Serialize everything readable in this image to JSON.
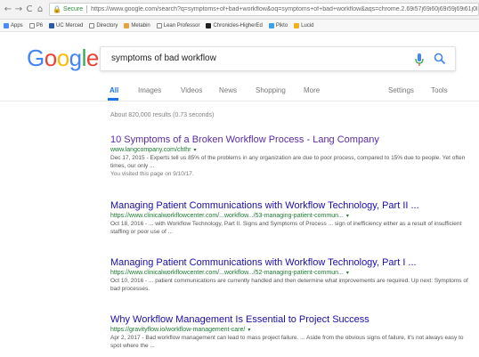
{
  "browser": {
    "back": "←",
    "forward": "→",
    "reload": "C",
    "home": "⌂",
    "lock": "🔒",
    "secure_label": "Secure",
    "url": "https://www.google.com/search?q=symptoms+of+bad+workflow&oq=symptoms+of+bad+workflow&aqs=chrome.2.69i57j69i60j69i59j69i61j0l2.5161"
  },
  "bookmarks": [
    {
      "label": "Apps",
      "color": "#4c8bf5"
    },
    {
      "label": "P6",
      "color": "#888888"
    },
    {
      "label": "UC Merced",
      "color": "#2b5aa8"
    },
    {
      "label": "Directory",
      "color": "#888888"
    },
    {
      "label": "Metabin",
      "color": "#e8a23a"
    },
    {
      "label": "Lean Professor",
      "color": "#888888"
    },
    {
      "label": "Chronicles-HigherEd",
      "color": "#1f1f1f"
    },
    {
      "label": "Pikto",
      "color": "#3aa0e8"
    },
    {
      "label": "Lucid",
      "color": "#f2b01e"
    }
  ],
  "google": {
    "logo_letters": [
      "G",
      "o",
      "o",
      "g",
      "l",
      "e"
    ],
    "logo_colors": [
      "#4285F4",
      "#EA4335",
      "#FBBC05",
      "#4285F4",
      "#34A853",
      "#EA4335"
    ],
    "query": "symptoms of bad workflow"
  },
  "tabs": {
    "all": "All",
    "images": "Images",
    "videos": "Videos",
    "news": "News",
    "shopping": "Shopping",
    "more": "More",
    "settings": "Settings",
    "tools": "Tools"
  },
  "stats": "About 820,000 results (0.73 seconds)",
  "results": [
    {
      "title": "10 Symptoms of a Broken Workflow Process - Lang Company",
      "url": "www.langcompany.com/chthr",
      "snippet": "Dec 17, 2015 - Experts tell us 85% of the problems in any organization are due to poor process, compared to 15% due to people. Yet often times, our only ...",
      "visited": "You visited this page on 9/10/17."
    },
    {
      "title": "Managing Patient Communications with Workflow Technology, Part II ...",
      "url": "https://www.clinicalworkflowcenter.com/...workflow.../53-managing-patient-commun...",
      "snippet": "Oct 18, 2016 - ... with Workflow Technology, Part II. Signs and Symptoms of Process ... sign of inefficiency either as a result of insufficient staffing or poor use of ..."
    },
    {
      "title": "Managing Patient Communications with Workflow Technology, Part I ...",
      "url": "https://www.clinicalworkflowcenter.com/...workflow.../52-managing-patient-commun...",
      "snippet": "Oct 10, 2016 - ... patient communications are currently handled and then determine what improvements are required. Up next: Symptoms of bad processes."
    },
    {
      "title": "Why Workflow Management Is Essential to Project Success",
      "url": "https://gravityflow.io/workflow-management-care/",
      "snippet": "Apr 2, 2017 - Bad workflow management can lead to mass project failure. ... Aside from the obvious signs of failure, it's not always easy to spot where the ..."
    }
  ],
  "caret": "▾"
}
